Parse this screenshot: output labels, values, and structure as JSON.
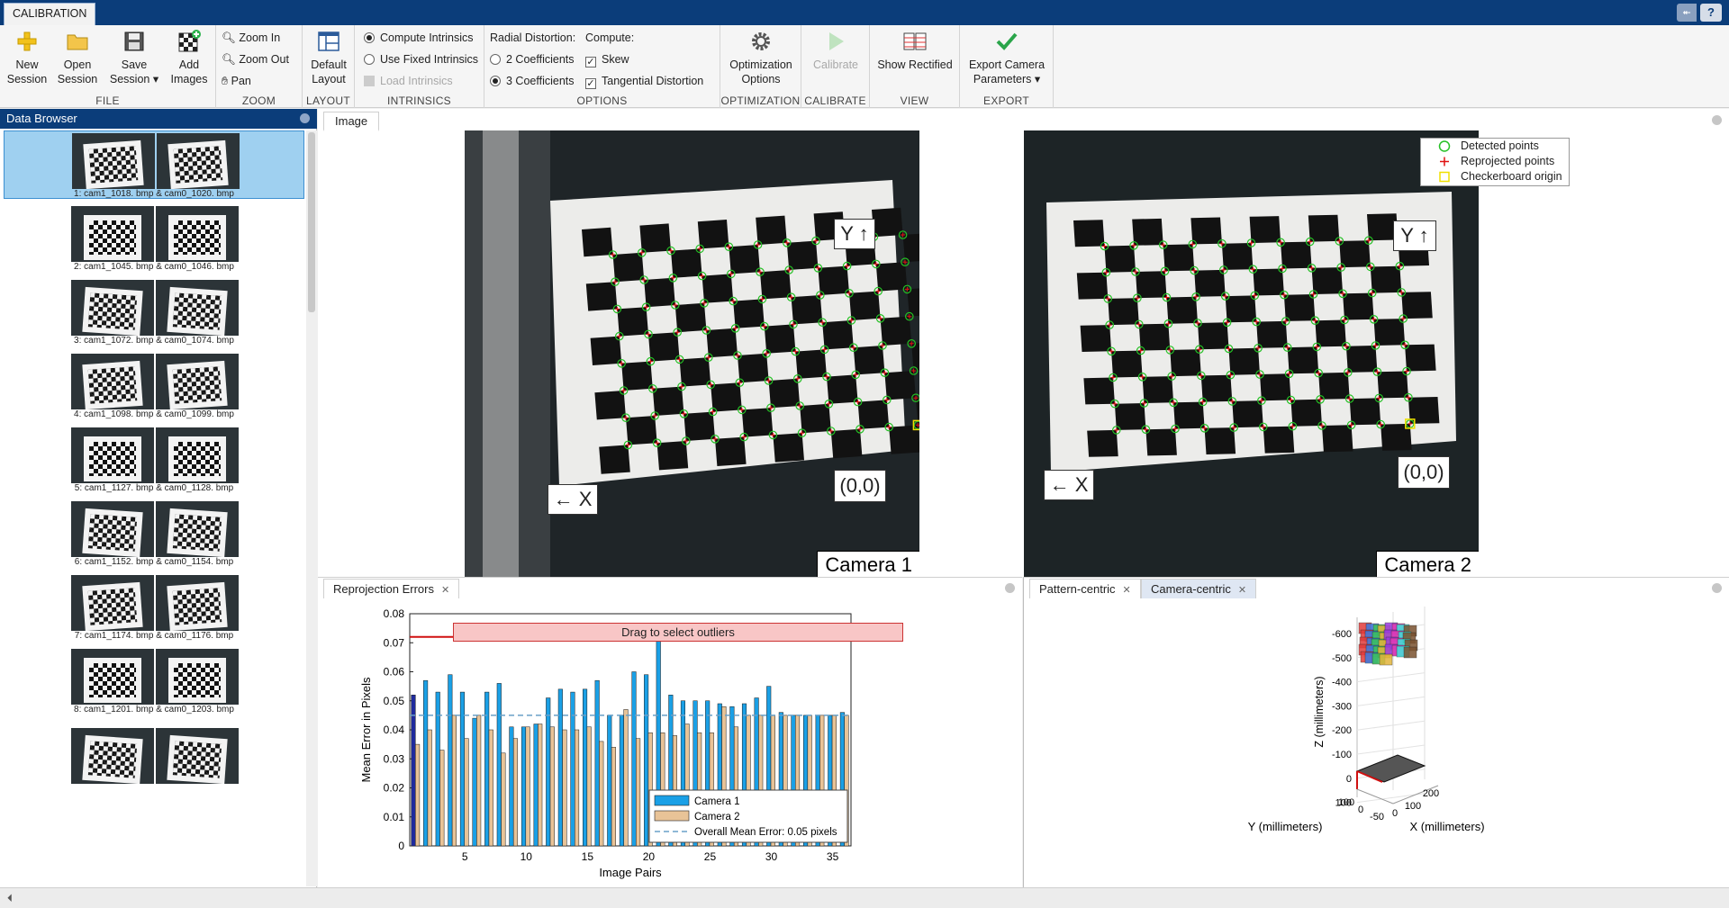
{
  "app": {
    "tab": "CALIBRATION",
    "help_label": "?",
    "collapse_label": "⯬"
  },
  "toolstrip": {
    "file": {
      "label": "FILE",
      "new_session": [
        "New",
        "Session"
      ],
      "open_session": [
        "Open",
        "Session"
      ],
      "save_session": [
        "Save",
        "Session ▾"
      ],
      "add_images": [
        "Add",
        "Images"
      ]
    },
    "zoom": {
      "label": "ZOOM",
      "zoom_in": "Zoom In",
      "zoom_out": "Zoom Out",
      "pan": "Pan"
    },
    "layout": {
      "label": "LAYOUT",
      "default_layout": [
        "Default",
        "Layout"
      ]
    },
    "intrinsics": {
      "label": "INTRINSICS",
      "compute": "Compute Intrinsics",
      "use_fixed": "Use Fixed Intrinsics",
      "load": "Load Intrinsics",
      "selected": "compute"
    },
    "options": {
      "label": "OPTIONS",
      "radial_title": "Radial Distortion:",
      "compute_title": "Compute:",
      "two_coeff": "2 Coefficients",
      "three_coeff": "3 Coefficients",
      "radial_selected": "3",
      "skew": "Skew",
      "skew_checked": true,
      "tangential": "Tangential Distortion",
      "tangential_checked": true
    },
    "optimization": {
      "label": "OPTIMIZATION",
      "button": [
        "Optimization",
        "Options"
      ]
    },
    "calibrate": {
      "label": "CALIBRATE",
      "button": "Calibrate"
    },
    "view": {
      "label": "VIEW",
      "button": "Show Rectified"
    },
    "export": {
      "label": "EXPORT",
      "button": [
        "Export Camera",
        "Parameters ▾"
      ]
    }
  },
  "data_browser": {
    "title": "Data Browser",
    "items": [
      {
        "caption": "1:  cam1_1018. bmp  &  cam0_1020. bmp",
        "selected": true
      },
      {
        "caption": "2:  cam1_1045. bmp  &  cam0_1046. bmp",
        "selected": false
      },
      {
        "caption": "3:  cam1_1072. bmp  &  cam0_1074. bmp",
        "selected": false
      },
      {
        "caption": "4:  cam1_1098. bmp  &  cam0_1099. bmp",
        "selected": false
      },
      {
        "caption": "5:  cam1_1127. bmp  &  cam0_1128. bmp",
        "selected": false
      },
      {
        "caption": "6:  cam1_1152. bmp  &  cam0_1154. bmp",
        "selected": false
      },
      {
        "caption": "7:  cam1_1174. bmp  &  cam0_1176. bmp",
        "selected": false
      },
      {
        "caption": "8:  cam1_1201. bmp  &  cam0_1203. bmp",
        "selected": false
      },
      {
        "caption": "",
        "selected": false
      }
    ]
  },
  "image_panel": {
    "tab": "Image",
    "camera1_label": "Camera 1",
    "camera2_label": "Camera 2",
    "axis_y_label": "Y ↑",
    "axis_x_label": "← X",
    "origin_label": "(0,0)",
    "legend": {
      "detected": "Detected points",
      "reprojected": "Reprojected points",
      "origin": "Checkerboard origin"
    }
  },
  "reprojection_panel": {
    "tab": "Reprojection Errors",
    "drag_label": "Drag to select outliers"
  },
  "viz_panel": {
    "tab1": "Pattern-centric",
    "tab2": "Camera-centric"
  },
  "chart_data": [
    {
      "type": "bar",
      "title": "",
      "xlabel": "Image Pairs",
      "ylabel": "Mean Error in Pixels",
      "ylim": [
        0,
        0.08
      ],
      "xlim": [
        0.5,
        36.5
      ],
      "yticks": [
        "0",
        "0.01",
        "0.02",
        "0.03",
        "0.04",
        "0.05",
        "0.06",
        "0.07",
        "0.08"
      ],
      "xticks": [
        5,
        10,
        15,
        20,
        25,
        30,
        35
      ],
      "categories": [
        1,
        2,
        3,
        4,
        5,
        6,
        7,
        8,
        9,
        10,
        11,
        12,
        13,
        14,
        15,
        16,
        17,
        18,
        19,
        20,
        21,
        22,
        23,
        24,
        25,
        26,
        27,
        28,
        29,
        30,
        31,
        32,
        33,
        34,
        35,
        36
      ],
      "series": [
        {
          "name": "Camera 1",
          "color": "#1aa0e6",
          "values": [
            0.052,
            0.057,
            0.053,
            0.059,
            0.053,
            0.044,
            0.053,
            0.056,
            0.041,
            0.041,
            0.042,
            0.051,
            0.054,
            0.053,
            0.054,
            0.057,
            0.045,
            0.045,
            0.06,
            0.059,
            0.073,
            0.052,
            0.05,
            0.05,
            0.05,
            0.049,
            0.048,
            0.049,
            0.051,
            0.055,
            0.046,
            0.045,
            0.045,
            0.045,
            0.045,
            0.046
          ]
        },
        {
          "name": "Camera 2",
          "color": "#e8c397",
          "values": [
            0.035,
            0.04,
            0.033,
            0.045,
            0.037,
            0.045,
            0.04,
            0.032,
            0.037,
            0.041,
            0.042,
            0.041,
            0.04,
            0.04,
            0.041,
            0.036,
            0.034,
            0.047,
            0.037,
            0.039,
            0.039,
            0.038,
            0.042,
            0.039,
            0.039,
            0.048,
            0.041,
            0.045,
            0.045,
            0.045,
            0.045,
            0.045,
            0.045,
            0.045,
            0.045,
            0.045
          ]
        }
      ],
      "threshold": 0.072,
      "mean_error": 0.045,
      "legend": [
        "Camera 1",
        "Camera 2",
        "Overall Mean Error: 0.05 pixels"
      ],
      "legend_position": "bottom-right"
    },
    {
      "type": "scatter",
      "title": "",
      "xlabel": "X (millimeters)",
      "ylabel": "Y (millimeters)",
      "zlabel": "Z (millimeters)",
      "zticks": [
        "-600",
        "-500",
        "-400",
        "-300",
        "-200",
        "-100",
        "0",
        "100"
      ],
      "xticks": [
        "0",
        "100",
        "200"
      ],
      "yticks": [
        "100",
        "0",
        "-50"
      ]
    }
  ],
  "colors": {
    "accent": "#0b3d7a",
    "selection": "#9fd0f0",
    "detected": "#25c025",
    "reprojected": "#e01010",
    "origin": "#f0e000"
  }
}
